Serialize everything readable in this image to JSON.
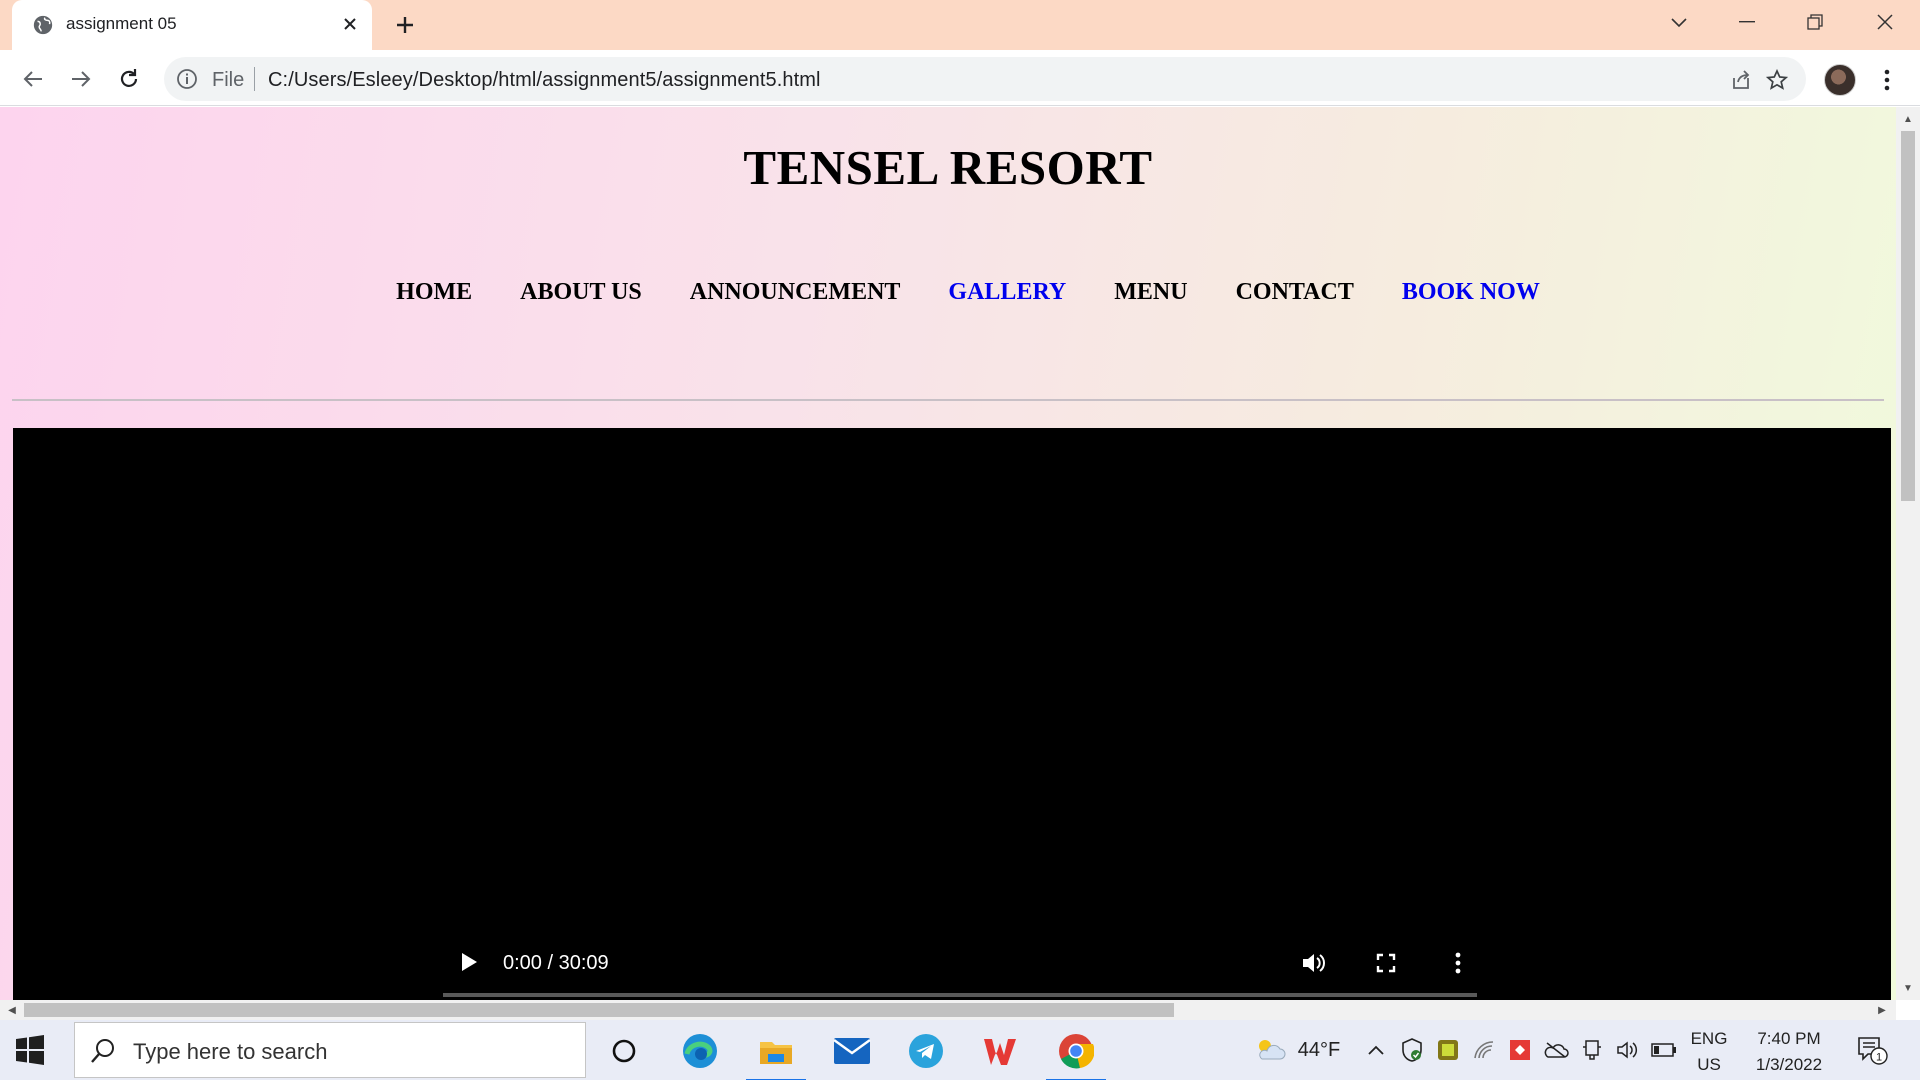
{
  "browser": {
    "tab_title": "assignment 05",
    "omnibox_scheme": "File",
    "url": "C:/Users/Esleey/Desktop/html/assignment5/assignment5.html"
  },
  "page": {
    "title": "TENSEL RESORT",
    "nav": [
      {
        "label": "HOME",
        "accent": false
      },
      {
        "label": "ABOUT US",
        "accent": false
      },
      {
        "label": "ANNOUNCEMENT",
        "accent": false
      },
      {
        "label": "GALLERY",
        "accent": true
      },
      {
        "label": "MENU",
        "accent": false
      },
      {
        "label": "CONTACT",
        "accent": false
      },
      {
        "label": "BOOK NOW",
        "accent": true
      }
    ],
    "video": {
      "time": "0:00 / 30:09",
      "progress": 0
    },
    "colors": {
      "accent_link": "#0000ee",
      "text": "#000000"
    }
  },
  "taskbar": {
    "search_placeholder": "Type here to search",
    "weather": "44°F",
    "lang_line1": "ENG",
    "lang_line2": "US",
    "time": "7:40 PM",
    "date": "1/3/2022",
    "notification_count": "1"
  }
}
